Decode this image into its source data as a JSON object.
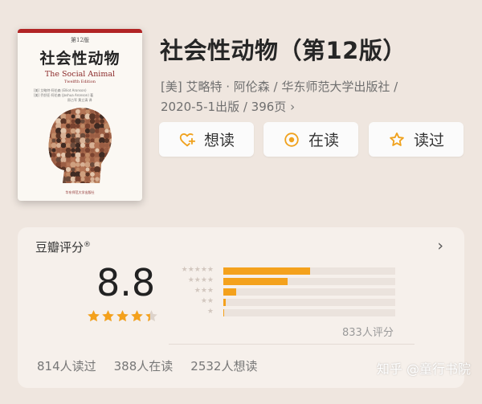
{
  "book": {
    "title": "社会性动物（第12版）",
    "meta_line1": "[美] 艾略特 · 阿伦森 / 华东师范大学出版社 /",
    "meta_line2": "2020-5-1出版 / 396页",
    "meta_chevron": "›"
  },
  "cover": {
    "edition": "第12版",
    "title": "社会性动物",
    "english_title": "The Social Animal",
    "english_edition": "Twelfth Edition",
    "author_line1": "[美] 艾略特·阿伦森 (Elliot Aronson)",
    "author_line2": "[美] 乔舒亚·阿伦森 (Joshua Aronson) 著",
    "translators": "邢占军 黄立清 译",
    "publisher": "华东师范大学出版社"
  },
  "actions": {
    "want": {
      "label": "想读",
      "icon": "heart-plus-icon"
    },
    "reading": {
      "label": "在读",
      "icon": "target-circle-icon"
    },
    "read": {
      "label": "读过",
      "icon": "star-outline-icon"
    }
  },
  "rating": {
    "card_title": "豆瓣评分",
    "registered_mark": "®",
    "chevron": "›",
    "score": "8.8",
    "stars_value": 4.4,
    "count_text": "833人评分",
    "distribution": [
      {
        "stars": 5,
        "fraction": 0.505
      },
      {
        "stars": 4,
        "fraction": 0.375
      },
      {
        "stars": 3,
        "fraction": 0.075
      },
      {
        "stars": 2,
        "fraction": 0.015
      },
      {
        "stars": 1,
        "fraction": 0.005
      }
    ]
  },
  "stats": {
    "read": "814人读过",
    "reading": "388人在读",
    "want": "2532人想读"
  },
  "watermark": "知乎 @童行书院",
  "colors": {
    "accent": "#f4a11c",
    "button_icon": "#f0a21e",
    "background": "#efe6df",
    "card": "#f6f0eb"
  }
}
